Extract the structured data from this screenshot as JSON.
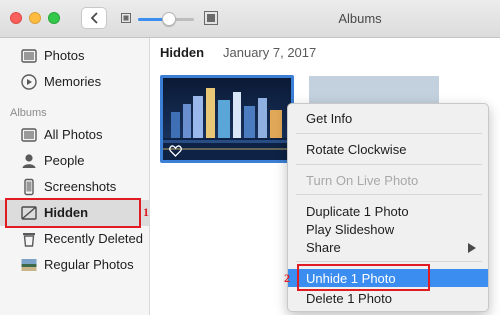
{
  "window": {
    "title": "Albums"
  },
  "sidebar": {
    "items_top": [
      {
        "label": "Photos",
        "icon": "photos-icon"
      },
      {
        "label": "Memories",
        "icon": "memories-icon"
      }
    ],
    "section_label": "Albums",
    "albums": [
      {
        "label": "All Photos",
        "icon": "all-photos-icon"
      },
      {
        "label": "People",
        "icon": "people-icon"
      },
      {
        "label": "Screenshots",
        "icon": "screenshots-icon"
      },
      {
        "label": "Hidden",
        "icon": "hidden-icon",
        "selected": true
      },
      {
        "label": "Recently Deleted",
        "icon": "trash-icon"
      },
      {
        "label": "Regular Photos",
        "icon": "album-thumbnail-icon"
      }
    ]
  },
  "main": {
    "title": "Hidden",
    "date": "January 7, 2017"
  },
  "zoom": {
    "level_fraction": 0.55
  },
  "context_menu": {
    "group1": [
      "Get Info"
    ],
    "group2": [
      "Rotate Clockwise"
    ],
    "group3": [
      "Turn On Live Photo"
    ],
    "group4": [
      "Duplicate 1 Photo",
      "Play Slideshow",
      "Share"
    ],
    "group5": [
      "Unhide 1 Photo",
      "Delete 1 Photo"
    ],
    "highlighted": "Unhide 1 Photo",
    "disabled": "Turn On Live Photo"
  },
  "annotations": {
    "step1": "1",
    "step2": "2",
    "color": "#e01b24"
  },
  "colors": {
    "accent": "#3b8ef0",
    "selection": "#3b7fd6"
  }
}
